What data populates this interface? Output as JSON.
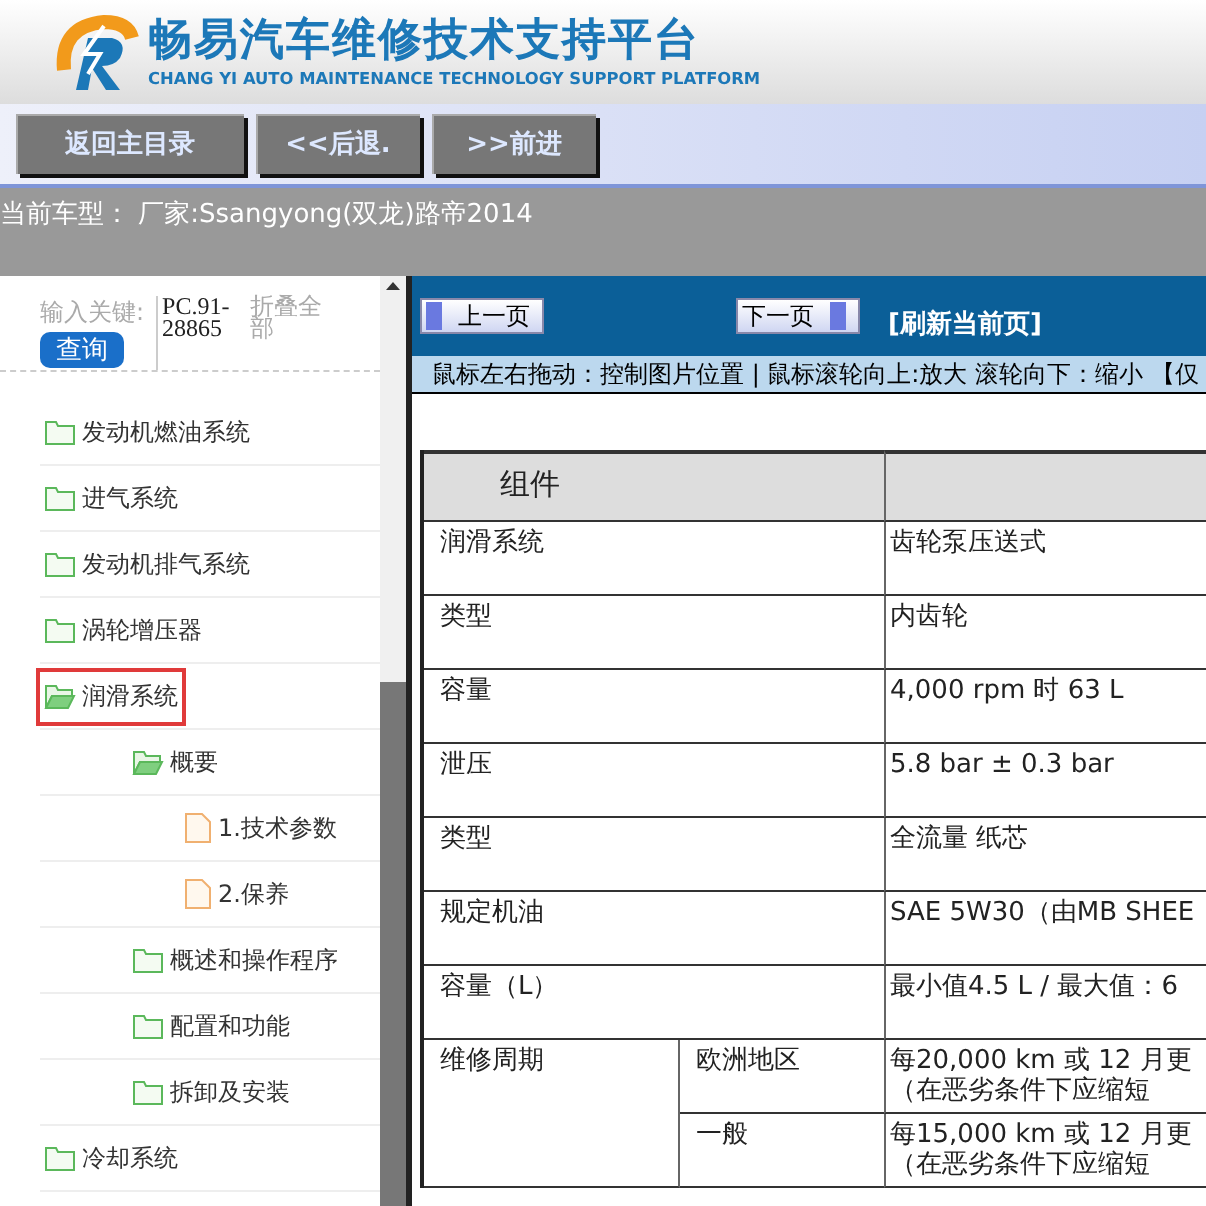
{
  "header": {
    "title": "畅易汽车维修技术支持平台",
    "subtitle": "CHANG YI AUTO MAINTENANCE TECHNOLOGY SUPPORT PLATFORM"
  },
  "nav_buttons": [
    "返回主目录",
    "<<后退.",
    ">>前进"
  ],
  "current_vehicle": "当前车型： 厂家:Ssangyong(双龙)路帝2014",
  "sidebar": {
    "keyword_label": "输入关键:",
    "search_button": "查询",
    "code": "PC.91-28865",
    "collapse_all": "折叠全部",
    "items": [
      {
        "kind": "folder",
        "label": "发动机燃油系统",
        "expanded": false,
        "selected": false
      },
      {
        "kind": "folder",
        "label": "进气系统",
        "expanded": false,
        "selected": false
      },
      {
        "kind": "folder",
        "label": "发动机排气系统",
        "expanded": false,
        "selected": false
      },
      {
        "kind": "folder",
        "label": "涡轮增压器",
        "expanded": false,
        "selected": false
      },
      {
        "kind": "folder",
        "label": "润滑系统",
        "expanded": true,
        "selected": true,
        "children": [
          {
            "kind": "folder",
            "label": "概要",
            "expanded": true,
            "selected": false,
            "children": [
              {
                "kind": "file",
                "label": "1.技术参数",
                "selected": false
              },
              {
                "kind": "file",
                "label": "2.保养",
                "selected": false
              }
            ]
          },
          {
            "kind": "folder",
            "label": "概述和操作程序",
            "expanded": false,
            "selected": false
          },
          {
            "kind": "folder",
            "label": "配置和功能",
            "expanded": false,
            "selected": false
          },
          {
            "kind": "folder",
            "label": "拆卸及安装",
            "expanded": false,
            "selected": false
          }
        ]
      },
      {
        "kind": "folder",
        "label": "冷却系统",
        "expanded": false,
        "selected": false
      }
    ]
  },
  "viewer": {
    "prev_button": "上一页",
    "next_button": "下一页",
    "refresh_link": "[刷新当前页]",
    "hint": "鼠标左右拖动：控制图片位置 | 鼠标滚轮向上:放大  滚轮向下：缩小 【仅",
    "table": {
      "columns": [
        "组件",
        ""
      ],
      "rows": [
        {
          "cells": [
            "润滑系统",
            "齿轮泵压送式"
          ]
        },
        {
          "cells": [
            "类型",
            "内齿轮"
          ]
        },
        {
          "cells": [
            "容量",
            "4,000 rpm 时 63 L"
          ]
        },
        {
          "cells": [
            "泄压",
            "5.8 bar ± 0.3 bar"
          ]
        },
        {
          "cells": [
            "类型",
            "全流量 纸芯"
          ]
        },
        {
          "cells": [
            "规定机油",
            "SAE 5W30（由MB SHEE"
          ]
        },
        {
          "cells": [
            "容量（L）",
            "最小值4.5 L / 最大值：6"
          ]
        },
        {
          "group": "维修周期",
          "sub": [
            {
              "cells": [
                "欧洲地区",
                "每20,000 km 或 12 月更",
                "（在恶劣条件下应缩短"
              ]
            },
            {
              "cells": [
                "一般",
                "每15,000 km 或 12 月更",
                "（在恶劣条件下应缩短"
              ]
            }
          ]
        }
      ]
    }
  }
}
